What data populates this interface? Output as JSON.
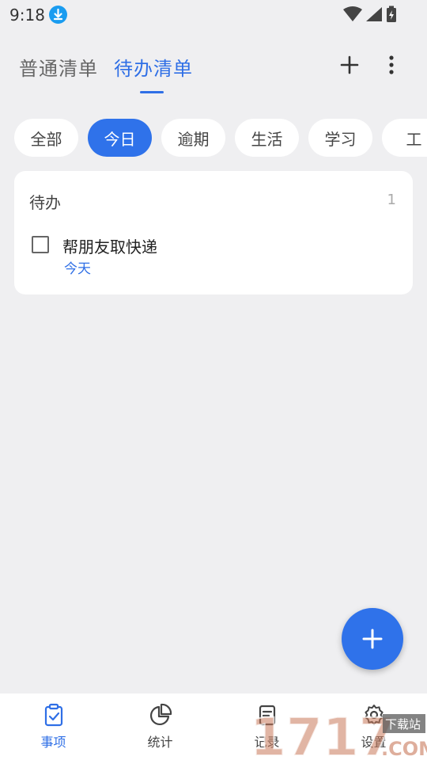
{
  "status": {
    "time": "9:18"
  },
  "header": {
    "tabs": [
      {
        "label": "普通清单"
      },
      {
        "label": "待办清单"
      }
    ]
  },
  "chips": [
    "全部",
    "今日",
    "逾期",
    "生活",
    "学习",
    "工"
  ],
  "card": {
    "title": "待办",
    "count": "1",
    "tasks": [
      {
        "title": "帮朋友取快递",
        "due": "今天"
      }
    ]
  },
  "nav": [
    {
      "label": "事项"
    },
    {
      "label": "统计"
    },
    {
      "label": "记录"
    },
    {
      "label": "设置"
    }
  ],
  "watermark": {
    "text": "1717",
    "tag": "下载站",
    "com": ".COM"
  },
  "colors": {
    "accent": "#2f72ea",
    "background": "#efeff1"
  }
}
